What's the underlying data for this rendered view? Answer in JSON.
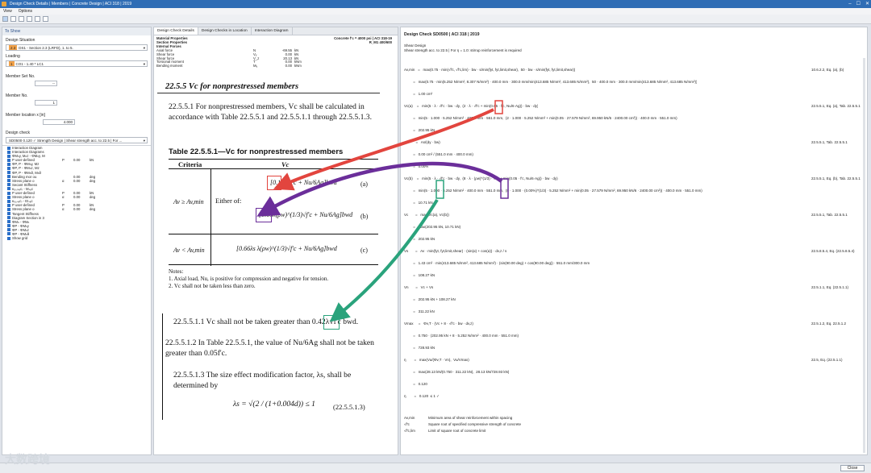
{
  "window": {
    "title": "Design Check Details | Members | Concrete Design | ACI 318 | 2019",
    "controls": [
      "–",
      "☐",
      "✕"
    ]
  },
  "menu": [
    "View",
    "Options"
  ],
  "left": {
    "to_show": "To Show",
    "design_situation_label": "Design Situation",
    "design_situation_chip": "2.3",
    "design_situation_value": "DS1 - Section 2.3 (LRFD), 1. to 5.",
    "loading_label": "Loading",
    "loading_chip": "1",
    "loading_value": "CO1 - 1.40 * LC1",
    "member_set_label": "Member Set No.",
    "member_set_value": "--",
    "member_label": "Member No.",
    "member_value": "1",
    "location_label": "Member location x [in]",
    "location_value": "4.000",
    "location_unit": "in",
    "design_check_label": "Design check",
    "design_check_value": "SD0500   0.120 ✓   Strength Design | Shear strength acc. to 22.5 | For ...",
    "tree": [
      {
        "t": "Interaction Diagram",
        "v": "",
        "u": "",
        "w": ""
      },
      {
        "t": "Interaction Diagrams",
        "v": "",
        "u": "",
        "w": ""
      },
      {
        "t": "ΦMₙy, Mₙz - ΦMₙy, M",
        "v": "",
        "u": "",
        "w": ""
      },
      {
        "t": "P user-defined",
        "v": "P",
        "u": "0.00",
        "w": "kN"
      },
      {
        "t": "ΦP, P - ΦMₙy, Mz",
        "v": "",
        "u": "",
        "w": ""
      },
      {
        "t": "ΦP, P - ΦMₙz, Mz",
        "v": "",
        "u": "",
        "w": ""
      },
      {
        "t": "ΦP, P - ΦMₙθ, Mₙθ",
        "v": "",
        "u": "",
        "w": ""
      },
      {
        "t": "Bending mor ou",
        "v": "",
        "u": "0.00",
        "w": "deg"
      },
      {
        "t": "Stress plane o",
        "v": "α",
        "u": "0.00",
        "w": "deg"
      },
      {
        "t": "Secant Stiffness",
        "v": "",
        "u": "",
        "w": ""
      },
      {
        "t": "κ₍ᵧ,₍ₛₑc₎ - Mₛₑc",
        "v": "",
        "u": "",
        "w": ""
      },
      {
        "t": "P user-defined",
        "v": "P",
        "u": "0.00",
        "w": "kN"
      },
      {
        "t": "Stress plane o",
        "v": "α",
        "u": "0.00",
        "w": "deg"
      },
      {
        "t": "κ₍ᵤ,ₛₑc₎ - EIₛₑc",
        "v": "",
        "u": "",
        "w": ""
      },
      {
        "t": "P user-defined",
        "v": "P",
        "u": "0.00",
        "w": "kN"
      },
      {
        "t": "Stress plane o",
        "v": "α",
        "u": "0.00",
        "w": "deg"
      },
      {
        "t": "Tangent Stiffness",
        "v": "",
        "u": "",
        "w": ""
      },
      {
        "t": "Diagram Section in 3",
        "v": "",
        "u": "",
        "w": ""
      },
      {
        "t": "ΦMₙ - ΦMₙ",
        "v": "",
        "u": "",
        "w": ""
      },
      {
        "t": "ΦP - ΦMₙy",
        "v": "",
        "u": "",
        "w": ""
      },
      {
        "t": "ΦP - ΦMₙz",
        "v": "",
        "u": "",
        "w": ""
      },
      {
        "t": "ΦP - ΦMₙθ",
        "v": "",
        "u": "",
        "w": ""
      },
      {
        "t": "Show grid",
        "v": "",
        "u": "",
        "w": ""
      }
    ]
  },
  "mid": {
    "tabs": [
      "Design Check Details",
      "Design Checks in Location",
      "Interaction Diagram"
    ],
    "props": [
      {
        "a": "Material Properties",
        "b": "",
        "c": "Concrete f'c = 4000 psi | ACI 318-19",
        "d": "",
        "sec": true
      },
      {
        "a": "Section Properties",
        "b": "",
        "c": "R_M1 400/600",
        "d": "",
        "sec": true
      },
      {
        "a": "Internal Forces",
        "b": "",
        "c": "",
        "d": "",
        "sec": true
      },
      {
        "a": "Axial force",
        "b": "N",
        "c": "-69.55",
        "d": "kN",
        "sec": false
      },
      {
        "a": "Shear force",
        "b": "Vᵧ",
        "c": "0.00",
        "d": "kN",
        "sec": false
      },
      {
        "a": "Shear force",
        "b": "V_z",
        "c": "20.13",
        "d": "kN",
        "sec": false
      },
      {
        "a": "Torsional moment",
        "b": "T",
        "c": "0.00",
        "d": "kNm",
        "sec": false
      },
      {
        "a": "Bending moment",
        "b": "Mᵧ",
        "c": "0.00",
        "d": "kNm",
        "sec": false
      }
    ],
    "doc": {
      "h1": "22.5.5 Vc for nonprestressed members",
      "p1": "22.5.5.1 For nonprestressed members, Vc shall be calculated in accordance with Table 22.5.5.1 and 22.5.5.1.1 through 22.5.5.1.3.",
      "table_title": "Table 22.5.5.1—Vc for nonprestressed members",
      "col_criteria": "Criteria",
      "col_vc": "Vc",
      "crit1": "Av ≥ Av,min",
      "either": "Either of:",
      "eq_a": "[0.17λ√f'c + Nu/6Ag]bwd",
      "eq_b": "[0.66λ(ρw)^(1/3)√f'c + Nu/6Ag]bwd",
      "crit2": "Av < Av,min",
      "eq_c": "[0.66λs λ(ρw)^(1/3)√f'c + Nu/6Ag]bwd",
      "tag_a": "(a)",
      "tag_b": "(b)",
      "tag_c": "(c)",
      "notes_h": "Notes:",
      "note1": "1. Axial load, Nu, is positive for compression and negative for tension.",
      "note2": "2. Vc shall not be taken less than zero.",
      "p11": "22.5.5.1.1 Vc shall not be taken greater than 0.42λ√f'c bwd.",
      "p12": "22.5.5.1.2 In Table 22.5.5.1, the value of Nu/6Ag shall not be taken greater than 0.05f'c.",
      "p13": "22.5.5.1.3 The size effect modification factor, λs, shall be determined by",
      "lambda_eq": "λs = √(2 / (1+0.004d)) ≤ 1",
      "lambda_tag": "(22.5.5.1.3)"
    }
  },
  "right": {
    "title": "Design Check SD0500 | ACI 318 | 2019",
    "subtitle1": "Shear Design",
    "subtitle2": "Shear strength acc. to 22.5 | For η = 1.0: stirrup reinforcement is required",
    "lines": [
      {
        "t": "Av,min   =   max(0.75 · min(√f'c, √f'c,lim) · bw · s/min(fyt, fyt,limit,shear),  50 · bw · s/min(fyt, fyt,limit,shear))",
        "r": "10.6.2.2, Eq. (a), (b)"
      },
      {
        "t": "         =   max(0.75 · min(5.252 N/mm², 8.307 N/mm²) · 400.0 mm · 300.0 mm/min(413.685 N/mm², 413.685 N/mm²),  50 · 400.0 mm · 300.0 mm/min(413.685 N/mm², 413.685 N/mm²))",
        "r": ""
      },
      {
        "t": "         =   1.00 cm²",
        "r": ""
      },
      {
        "t": "Vc(a)    =   min(5 · λ · √f'c · bw · dy,  (2 · λ · √f'c + min(0.05 · f'c, Nu/6·Ag)) · bw · dy)",
        "r": "22.5.5.1, Eq. (a), Tab. 22.5.5.1"
      },
      {
        "t": "         =   min(5 · 1.000 · 5.252 N/mm² · 400.0 mm · 551.0 mm,  (2 · 1.000 · 5.252 N/mm² + min(0.05 · 27.579 N/mm², 69.950 kN/6 · 2400.00 cm²)) · 400.0 mm · 551.0 mm)",
        "r": ""
      },
      {
        "t": "         =   202.95 kN",
        "r": ""
      },
      {
        "t": "ρw       =   As/(dy · bw)",
        "r": "22.5.5.1, Tab. 22.5.5.1"
      },
      {
        "t": "         =   0.00 cm² / (551.0 mm · 400.0 mm)",
        "r": ""
      },
      {
        "t": "         =   0.00%",
        "r": ""
      },
      {
        "t": "Vc(b)    =   min(5 · λ · √f'c · bw · dy,  (8 · λ · (ρw)^(1/3) · √f'c + min(0.05 · f'c, Nu/6·Ag)) · bw · dy)",
        "r": "22.5.5.1, Eq. (b), Tab. 22.5.5.1"
      },
      {
        "t": "         =   min(5 · 1.000 · 5.252 N/mm² · 400.0 mm · 551.0 mm,  (8 · 1.000 · (0.00%)^(1/3) · 5.252 N/mm² + min(0.05 · 27.579 N/mm², 69.950 kN/6 · 2400.00 cm²)) · 400.0 mm · 551.0 mm)",
        "r": ""
      },
      {
        "t": "         =   10.71 kN",
        "r": ""
      },
      {
        "t": "Vc       =   max(Vc(a), Vc(b))",
        "r": "22.5.5.1, Tab. 22.5.5.1"
      },
      {
        "t": "         =   max(202.95 kN, 10.71 kN)",
        "r": ""
      },
      {
        "t": "         =   202.95 kN",
        "r": ""
      },
      {
        "t": "Vs       =   Av · min(fyt, fyt,limit,shear) · (sin(α) + cos(α)) · dv,z / s",
        "r": "22.5.8.5.4, Eq. (22.5.8.5.4)"
      },
      {
        "t": "         =   1.43 cm² · min(413.685 N/mm², 413.685 N/mm²) · (sin(90.00 deg) + cos(90.00 deg)) · 551.0 mm/300.0 mm",
        "r": ""
      },
      {
        "t": "         =   108.27 kN",
        "r": ""
      },
      {
        "t": "Vn       =   Vc + Vs",
        "r": "22.5.1.1, Eq. (22.5.1.1)"
      },
      {
        "t": "         =   202.95 kN + 108.27 kN",
        "r": ""
      },
      {
        "t": "         =   311.22 kN",
        "r": ""
      },
      {
        "t": "Vmax     =   Φv,T · (Vc + 8 · √f'c · bw · dv,z)",
        "r": "22.5.1.2, Eq. 22.5.1.2"
      },
      {
        "t": "         =   0.750 · (202.95 kN + 8 · 5.252 N/mm² · 400.0 mm · 551.0 mm)",
        "r": ""
      },
      {
        "t": "         =   728.93 kN",
        "r": ""
      },
      {
        "t": "η        =   max(Vu/(Φv,T · Vn),  Vu/Vmax)",
        "r": "22.5, Eq. (22.5.1.1)"
      },
      {
        "t": "         =   max(28.13 kN/(0.750 · 311.22 kN),  28.13 kN/728.93 kN)",
        "r": ""
      },
      {
        "t": "         =   0.120",
        "r": ""
      },
      {
        "t": "η        =   0.120  ≤ 1 ✓",
        "r": ""
      }
    ],
    "legend": [
      {
        "s": "Av,min",
        "d": "Minimum area of shear reinforcement within spacing"
      },
      {
        "s": "√f'c",
        "d": "Square root of specified compressive strength of concrete"
      },
      {
        "s": "√f'c,lim",
        "d": "Limit of square root of concrete limit"
      }
    ]
  },
  "status": {
    "close": "Close"
  },
  "watermark": "大数跨境",
  "colors": {
    "title": "#2f6db5",
    "red_box": "#e2453e",
    "purple_box": "#6b2e9a",
    "teal_box": "#2aa37c"
  }
}
